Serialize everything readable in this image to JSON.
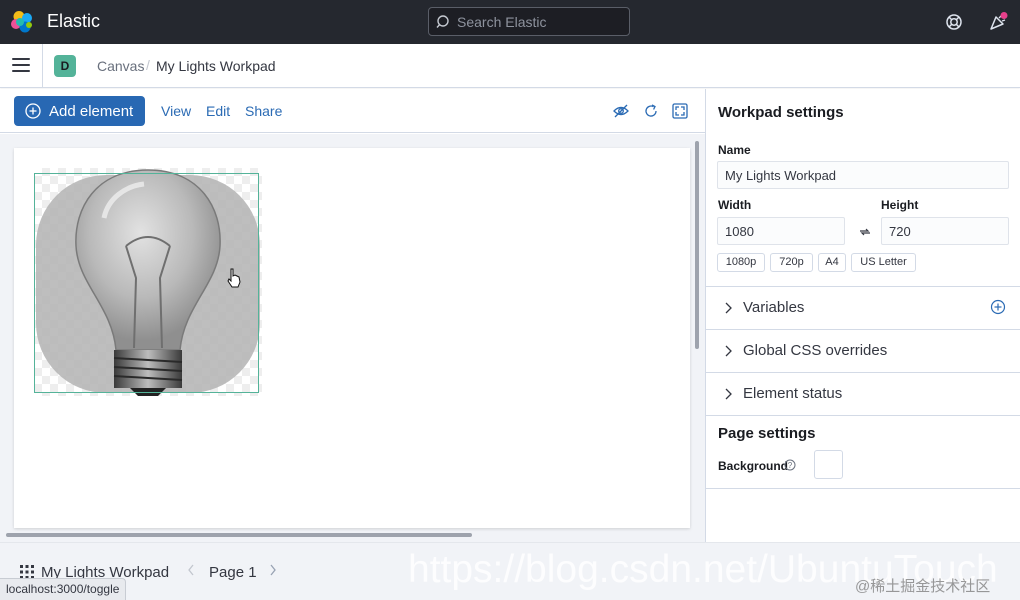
{
  "header": {
    "brand": "Elastic",
    "search_placeholder": "Search Elastic",
    "colors": {
      "background": "#25282f",
      "notification_dot": "#e7408b"
    }
  },
  "breadcrumbs": {
    "space_initial": "D",
    "items": [
      "Canvas",
      "My Lights Workpad"
    ],
    "separator": "/"
  },
  "toolbar": {
    "add_element": "Add element",
    "links": [
      "View",
      "Edit",
      "Share"
    ],
    "accent": "#2868b3"
  },
  "workpad_settings": {
    "title": "Workpad settings",
    "name_label": "Name",
    "name_value": "My Lights Workpad",
    "width_label": "Width",
    "width_value": "1080",
    "height_label": "Height",
    "height_value": "720",
    "presets": [
      "1080p",
      "720p",
      "A4",
      "US Letter"
    ],
    "sections": [
      "Variables",
      "Global CSS overrides",
      "Element status"
    ]
  },
  "page_settings": {
    "title": "Page settings",
    "background_label": "Background",
    "background_color": "#ffffff"
  },
  "bottom_bar": {
    "workpad_title": "My Lights Workpad",
    "page_label": "Page 1"
  },
  "watermark": {
    "url": "https://blog.csdn.net/UbuntuTouch",
    "credit": "@稀土掘金技术社区"
  },
  "status_bar": {
    "url": "localhost:3000/toggle"
  }
}
